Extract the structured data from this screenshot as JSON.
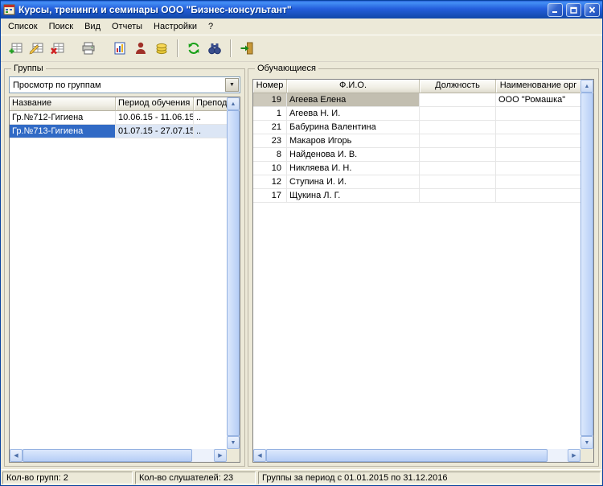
{
  "window": {
    "title": "Курсы, тренинги и семинары ООО \"Бизнес-консультант\""
  },
  "menu": {
    "items": [
      "Список",
      "Поиск",
      "Вид",
      "Отчеты",
      "Настройки",
      "?"
    ]
  },
  "toolbar": {
    "icons": [
      "add-record",
      "edit-record",
      "delete-record",
      "print",
      "report",
      "person",
      "payments",
      "refresh",
      "find",
      "exit"
    ]
  },
  "groups_panel": {
    "title": "Группы",
    "combo_value": "Просмотр по группам",
    "columns": [
      "Название",
      "Период обучения",
      "Преподава"
    ],
    "rows": [
      [
        "Гр.№712-Гигиена",
        "10.06.15 - 11.06.15",
        ".."
      ],
      [
        "Гр.№713-Гигиена",
        "01.07.15 - 27.07.15",
        ".."
      ]
    ],
    "selected_row": 1
  },
  "students_panel": {
    "title": "Обучающиеся",
    "columns": [
      "Номер",
      "Ф.И.О.",
      "Должность",
      "Наименование орг"
    ],
    "rows": [
      [
        "19",
        "Агеева Елена",
        "",
        "ООО \"Ромашка\""
      ],
      [
        "1",
        "Агеева Н. И.",
        "",
        ""
      ],
      [
        "21",
        "Бабурина Валентина",
        "",
        ""
      ],
      [
        "23",
        "Макаров Игорь",
        "",
        ""
      ],
      [
        "8",
        "Найденова И. В.",
        "",
        ""
      ],
      [
        "10",
        "Никляева И. Н.",
        "",
        ""
      ],
      [
        "12",
        "Ступина И. И.",
        "",
        ""
      ],
      [
        "17",
        "Щукина Л. Г.",
        "",
        ""
      ]
    ],
    "selected_row": 0
  },
  "status_bar": {
    "cells": [
      "Кол-во групп: 2",
      "Кол-во слушателей: 23",
      "Группы за период с 01.01.2015 по 31.12.2016"
    ]
  },
  "colors": {
    "titlebar": "#245EDC",
    "selection_active": "#316AC5",
    "selection_inactive": "#CDC9BC",
    "window_bg": "#ECE9D8"
  }
}
